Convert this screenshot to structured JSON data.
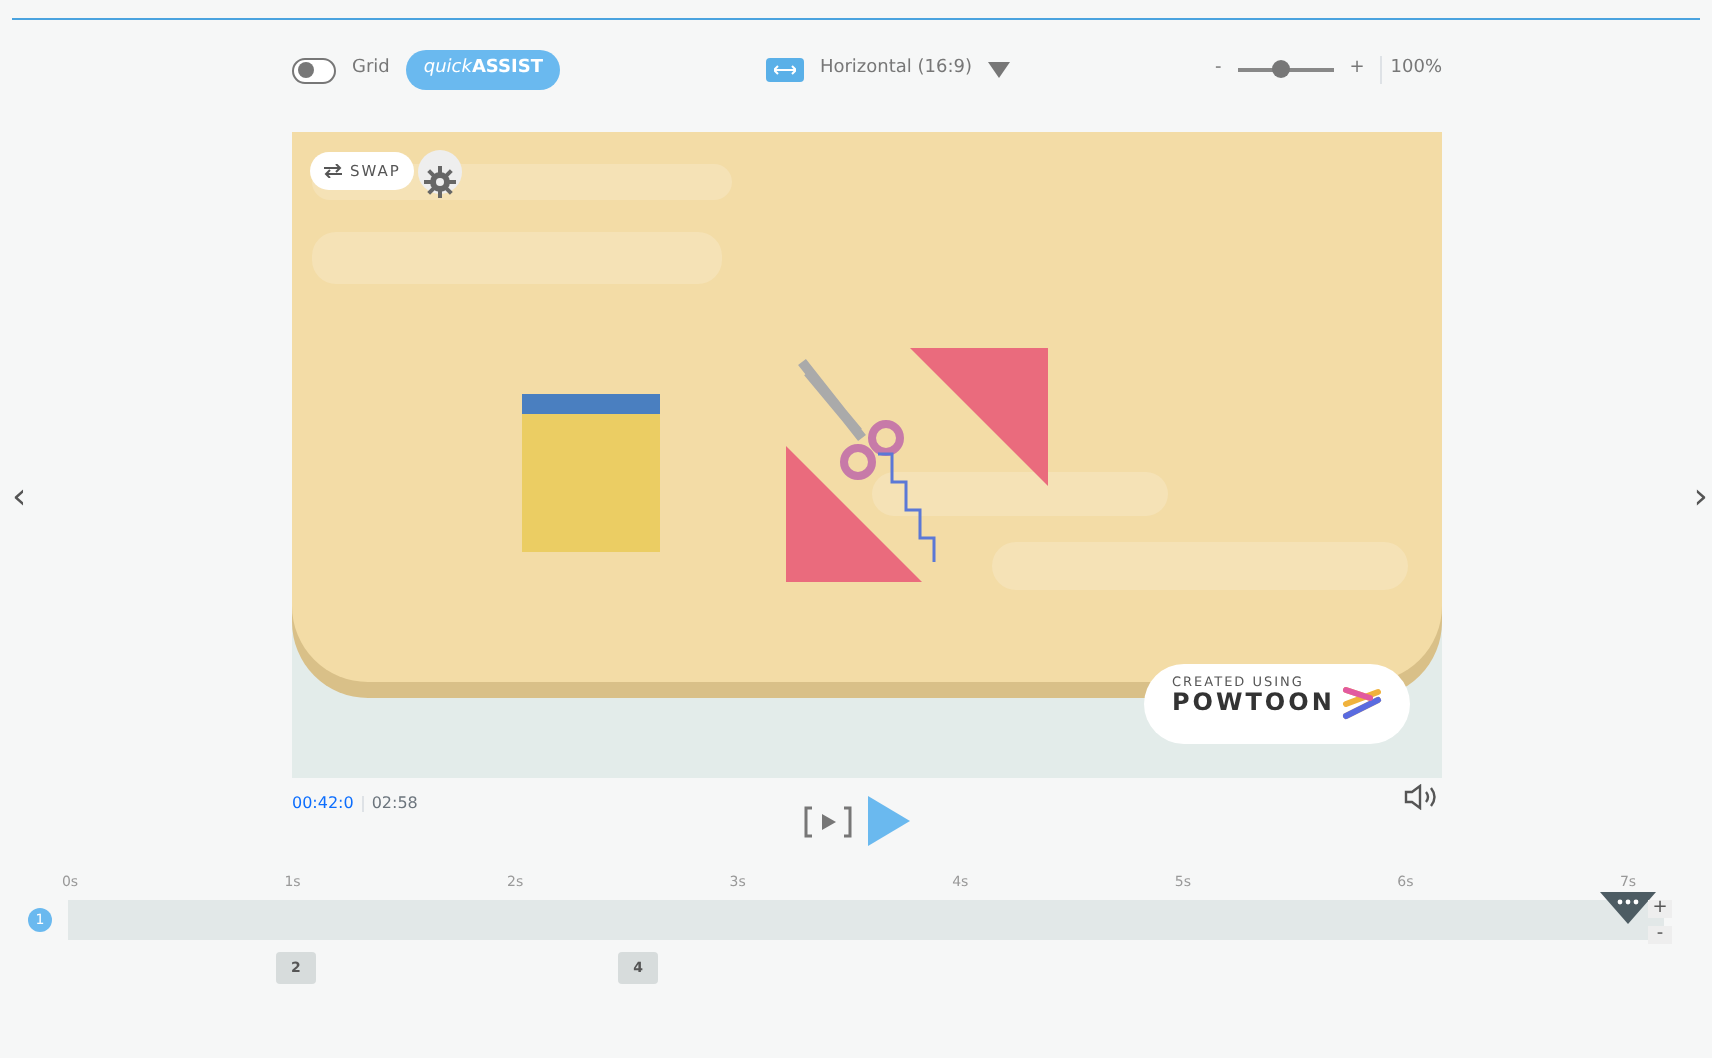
{
  "toolbar": {
    "grid": {
      "label": "Grid",
      "on": false
    },
    "quick_assist": {
      "label_italic": "quick",
      "label_bold": "ASSIST"
    },
    "orientation": {
      "label": "Horizontal (16:9)"
    },
    "zoom": {
      "minus": "-",
      "plus": "+",
      "level": 0.45,
      "reading": "100%"
    }
  },
  "stage": {
    "swap_label": "SWAP",
    "badge": {
      "line1": "CREATED USING",
      "line2": "POWTOON"
    }
  },
  "nav": {
    "prev": "‹",
    "next": "›"
  },
  "player": {
    "current_time": "00:42:0",
    "total_time": "02:58"
  },
  "timeline": {
    "ticks": [
      "0s",
      "1s",
      "2s",
      "3s",
      "4s",
      "5s",
      "6s",
      "7s"
    ],
    "track_label": "1",
    "zoom_in": "+",
    "zoom_out": "-",
    "markers": [
      {
        "label": "2"
      },
      {
        "label": "4"
      }
    ]
  }
}
